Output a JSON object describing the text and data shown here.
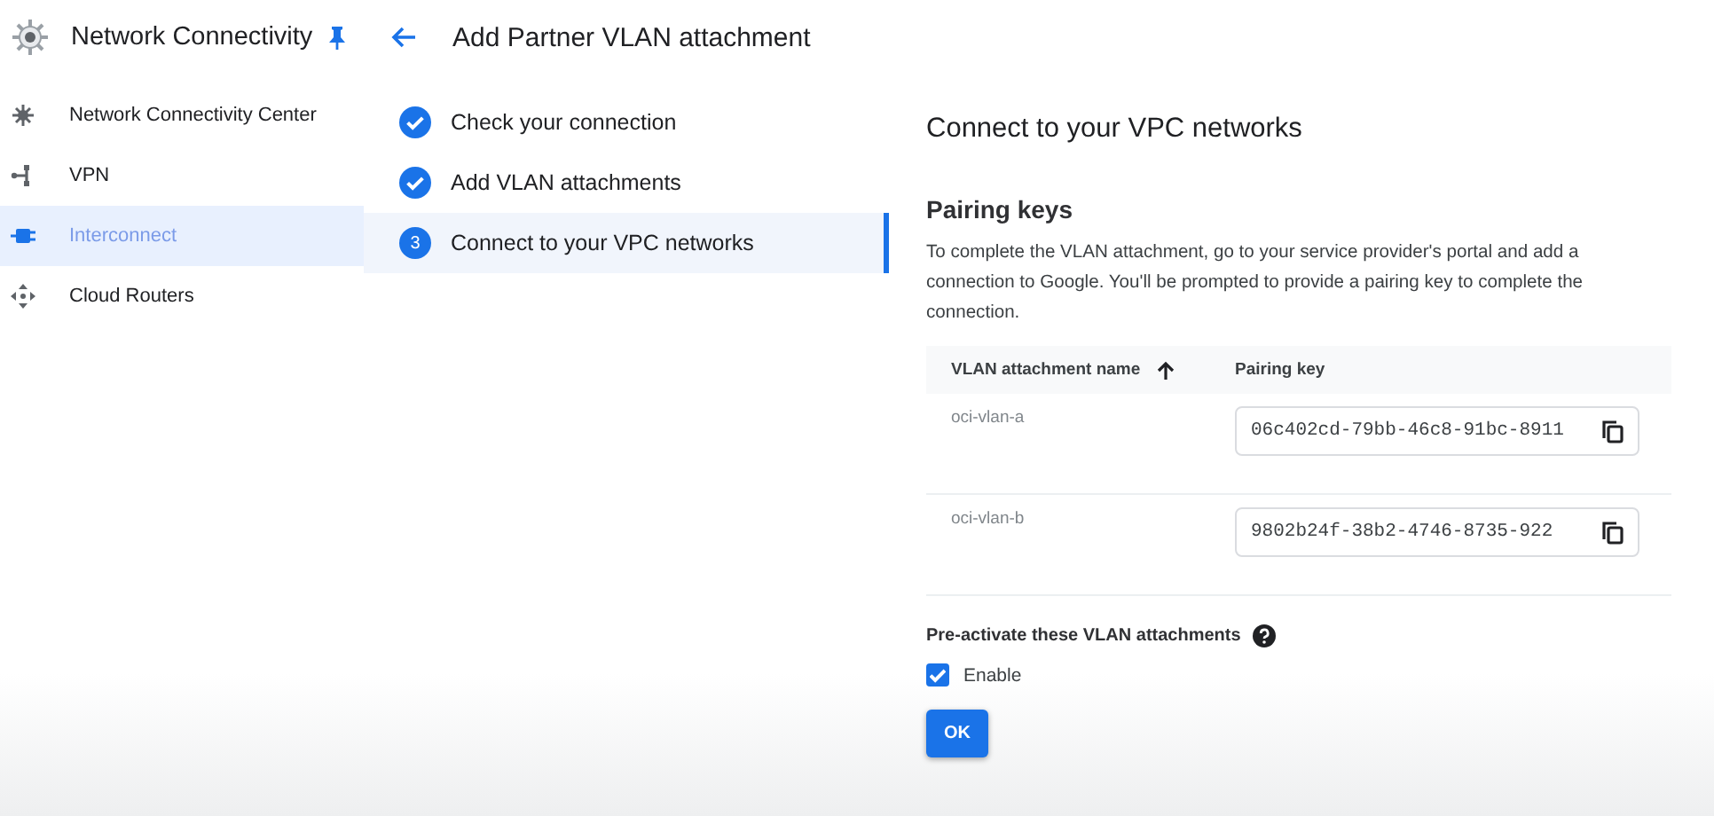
{
  "sidebar": {
    "title": "Network Connectivity",
    "pinned": true,
    "items": [
      {
        "label": "Network Connectivity Center",
        "kind": "hub",
        "selected": false
      },
      {
        "label": "VPN",
        "kind": "vpn",
        "selected": false
      },
      {
        "label": "Interconnect",
        "kind": "interconnect",
        "selected": true
      },
      {
        "label": "Cloud Routers",
        "kind": "router",
        "selected": false
      }
    ]
  },
  "page": {
    "title": "Add Partner VLAN attachment"
  },
  "steps": [
    {
      "label": "Check your connection",
      "done": true,
      "selected": false
    },
    {
      "label": "Add VLAN attachments",
      "done": true,
      "selected": false
    },
    {
      "label": "Connect to your VPC networks",
      "number": "3",
      "done": false,
      "selected": true
    }
  ],
  "content": {
    "title": "Connect to your VPC networks",
    "section": "Pairing keys",
    "description": "To complete the VLAN attachment, go to your service provider's portal and add a connection to Google. You'll be prompted to provide a pairing key to complete the connection.",
    "table": {
      "columns": [
        {
          "label": "VLAN attachment name",
          "sorted": true
        },
        {
          "label": "Pairing key"
        }
      ],
      "rows": [
        {
          "name": "oci-vlan-a",
          "key": "06c402cd-79bb-46c8-91bc-8911"
        },
        {
          "name": "oci-vlan-b",
          "key": "9802b24f-38b2-4746-8735-922"
        }
      ]
    },
    "preactivate": {
      "label": "Pre-activate these VLAN attachments",
      "checkbox_label": "Enable",
      "checked": true
    },
    "button": "OK"
  }
}
